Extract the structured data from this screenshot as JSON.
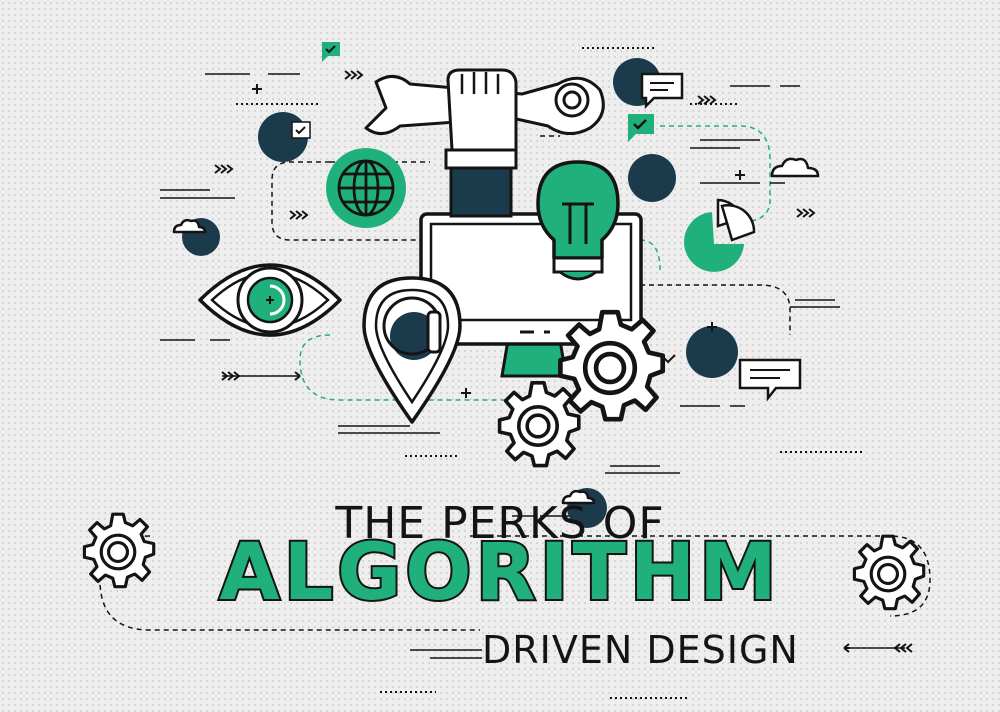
{
  "title": {
    "line1": "THE PERKS OF",
    "line2": "ALGORITHM",
    "line3": "DRIVEN DESIGN"
  },
  "colors": {
    "background": "#eeeeee",
    "accent_green": "#20b07b",
    "dark_navy": "#1b3a4b",
    "outline": "#141414",
    "white": "#ffffff"
  },
  "icons": [
    "wrench-icon",
    "hand-icon",
    "globe-icon",
    "lightbulb-icon",
    "monitor-icon",
    "eye-icon",
    "map-pin-icon",
    "magnifier-icon",
    "gear-icon",
    "pie-chart-icon",
    "cloud-icon",
    "speech-bubble-icon",
    "checkmark-icon",
    "arrow-icon",
    "plus-icon"
  ]
}
